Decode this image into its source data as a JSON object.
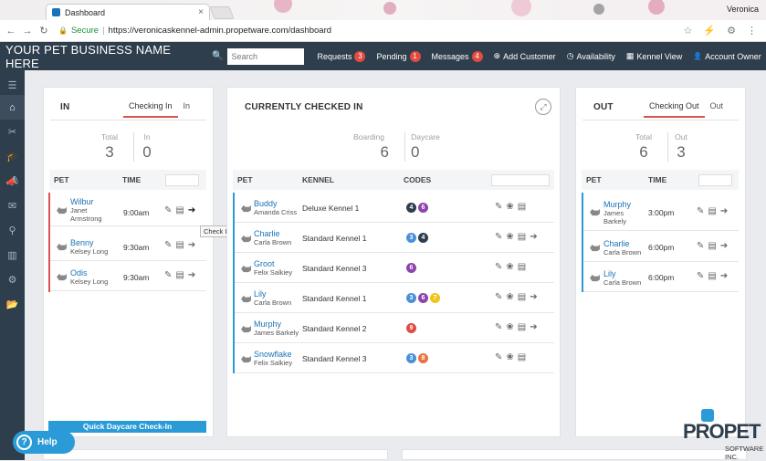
{
  "browser": {
    "tab_title": "Dashboard",
    "tab_close": "×",
    "user": "Veronica",
    "secure_label": "Secure",
    "separator": "|",
    "url": "https://veronicaskennel-admin.propetware.com/dashboard",
    "back": "←",
    "forward": "→",
    "reload": "↻",
    "lock_glyph": "🔒",
    "star": "☆",
    "ext": "⚡",
    "gear": "⚙",
    "more": "⋮"
  },
  "header": {
    "brand": "YOUR PET BUSINESS NAME HERE",
    "search_icon": "🔍",
    "search_placeholder": "Search",
    "menu": [
      {
        "label": "Requests",
        "badge": "3"
      },
      {
        "label": "Pending",
        "badge": "1"
      },
      {
        "label": "Messages",
        "badge": "4"
      },
      {
        "label": "Add Customer",
        "icon": "⊕"
      },
      {
        "label": "Availability",
        "icon": "◷"
      },
      {
        "label": "Kennel View",
        "icon": "▦"
      },
      {
        "label": "Account Owner",
        "icon": "👤"
      }
    ]
  },
  "sidebar": {
    "items": [
      "☰",
      "⌂",
      "✂",
      "🎓",
      "📣",
      "✉",
      "⚲",
      "▥",
      "⚙",
      "📂"
    ]
  },
  "in_panel": {
    "title": "IN",
    "tabs": [
      "Checking In",
      "In"
    ],
    "stats": [
      {
        "label": "Total",
        "value": "3"
      },
      {
        "label": "In",
        "value": "0"
      }
    ],
    "columns": [
      "PET",
      "TIME"
    ],
    "rows": [
      {
        "pet": "Wilbur",
        "owner": "Janet Armstrong",
        "time": "9:00am"
      },
      {
        "pet": "Benny",
        "owner": "Kelsey Long",
        "time": "9:30am"
      },
      {
        "pet": "Odis",
        "owner": "Kelsey Long",
        "time": "9:30am"
      }
    ],
    "tooltip": "Check In",
    "quick_button": "Quick Daycare Check-In"
  },
  "checked_panel": {
    "title": "CURRENTLY CHECKED IN",
    "expand_icon": "⤢",
    "stats": [
      {
        "label": "Boarding",
        "value": "6"
      },
      {
        "label": "Daycare",
        "value": "0"
      }
    ],
    "columns": [
      "PET",
      "KENNEL",
      "CODES"
    ],
    "rows": [
      {
        "pet": "Buddy",
        "owner": "Amanda Criss",
        "kennel": "Deluxe Kennel 1",
        "codes": [
          {
            "n": "4",
            "c": "#2f3e4c"
          },
          {
            "n": "6",
            "c": "#8e44ad"
          }
        ]
      },
      {
        "pet": "Charlie",
        "owner": "Carla Brown",
        "kennel": "Standard Kennel 1",
        "codes": [
          {
            "n": "3",
            "c": "#4a90d9"
          },
          {
            "n": "4",
            "c": "#2f3e4c"
          }
        ]
      },
      {
        "pet": "Groot",
        "owner": "Felix Salkiey",
        "kennel": "Standard Kennel 3",
        "codes": [
          {
            "n": "6",
            "c": "#8e44ad"
          }
        ]
      },
      {
        "pet": "Lily",
        "owner": "Carla Brown",
        "kennel": "Standard Kennel 1",
        "codes": [
          {
            "n": "3",
            "c": "#4a90d9"
          },
          {
            "n": "6",
            "c": "#8e44ad"
          },
          {
            "n": "7",
            "c": "#f0c419"
          }
        ]
      },
      {
        "pet": "Murphy",
        "owner": "James Barkely",
        "kennel": "Standard Kennel 2",
        "codes": [
          {
            "n": "9",
            "c": "#e14b40"
          }
        ]
      },
      {
        "pet": "Snowflake",
        "owner": "Felix Salkiey",
        "kennel": "Standard Kennel 3",
        "codes": [
          {
            "n": "3",
            "c": "#4a90d9"
          },
          {
            "n": "8",
            "c": "#e8743b"
          }
        ]
      }
    ]
  },
  "out_panel": {
    "title": "OUT",
    "tabs": [
      "Checking Out",
      "Out"
    ],
    "stats": [
      {
        "label": "Total",
        "value": "6"
      },
      {
        "label": "Out",
        "value": "3"
      }
    ],
    "columns": [
      "PET",
      "TIME"
    ],
    "rows": [
      {
        "pet": "Murphy",
        "owner": "James Barkely",
        "time": "3:00pm"
      },
      {
        "pet": "Charlie",
        "owner": "Carla Brown",
        "time": "6:00pm"
      },
      {
        "pet": "Lily",
        "owner": "Carla Brown",
        "time": "6:00pm"
      }
    ]
  },
  "help": {
    "label": "Help",
    "icon": "?"
  },
  "logo": {
    "brand": "PROPET",
    "sub": "SOFTWARE INC."
  },
  "colors": {
    "accent_red": "#d9534f",
    "accent_blue": "#2a9bd6",
    "header": "#2f3e4c"
  }
}
